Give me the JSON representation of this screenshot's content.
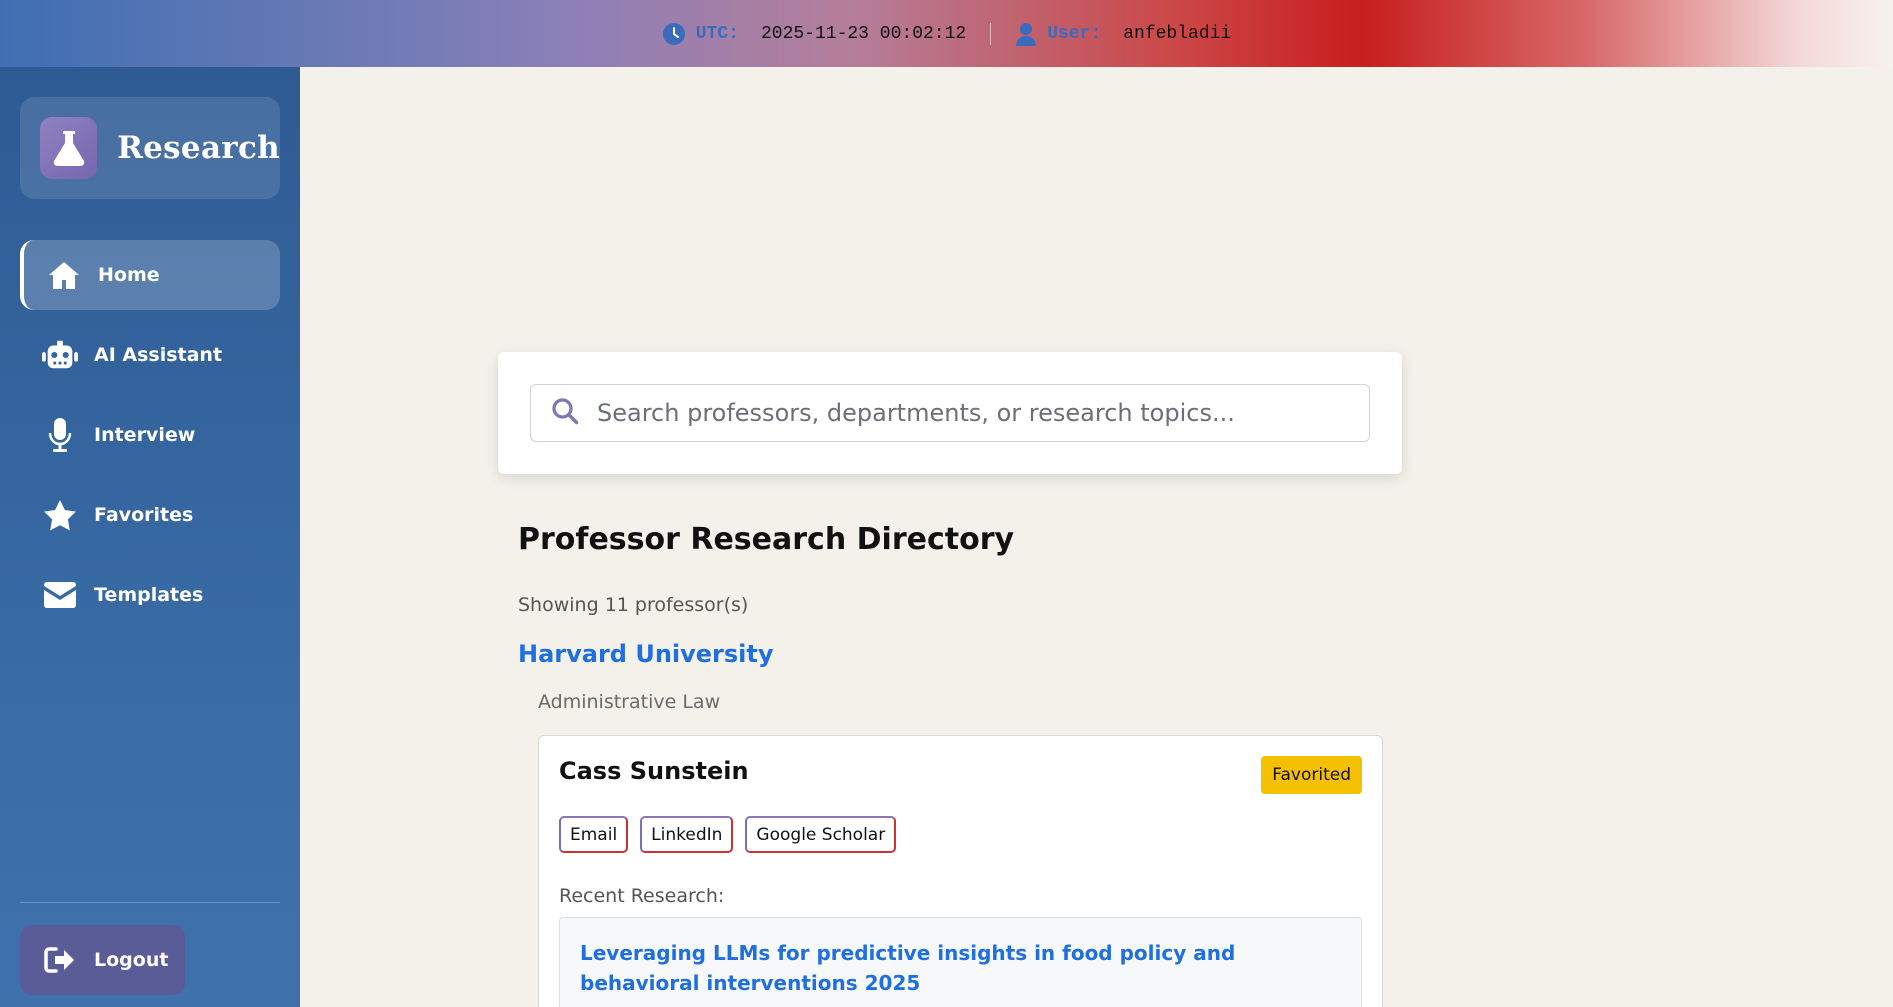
{
  "topbar": {
    "utc_label": "UTC:",
    "utc_value": "2025-11-23 00:02:12",
    "user_label": "User:",
    "user_value": "anfebladii",
    "icons": [
      "clock-icon",
      "user-icon"
    ]
  },
  "sidebar": {
    "brand": "Research",
    "brand_icon": "flask-icon",
    "items": [
      {
        "label": "Home",
        "icon": "home-icon",
        "active": true
      },
      {
        "label": "AI Assistant",
        "icon": "robot-icon",
        "active": false
      },
      {
        "label": "Interview",
        "icon": "microphone-icon",
        "active": false
      },
      {
        "label": "Favorites",
        "icon": "star-icon",
        "active": false
      },
      {
        "label": "Templates",
        "icon": "envelope-icon",
        "active": false
      }
    ],
    "logout": "Logout",
    "logout_icon": "logout-icon"
  },
  "search": {
    "placeholder": "Search professors, departments, or research topics..."
  },
  "main": {
    "title": "Professor Research Directory",
    "count": "Showing 11 professor(s)",
    "university": "Harvard University",
    "department": "Administrative Law",
    "professor": {
      "name": "Cass Sunstein",
      "badge": "Favorited",
      "links": [
        "Email",
        "LinkedIn",
        "Google Scholar"
      ],
      "recent_label": "Recent Research:",
      "paper_title": "Leveraging LLMs for predictive insights in food policy and behavioral interventions 2025"
    }
  },
  "colors": {
    "accent_blue": "#1f6fe0",
    "badge_yellow": "#f5c000",
    "sidebar_blue": "#2f5b94"
  }
}
